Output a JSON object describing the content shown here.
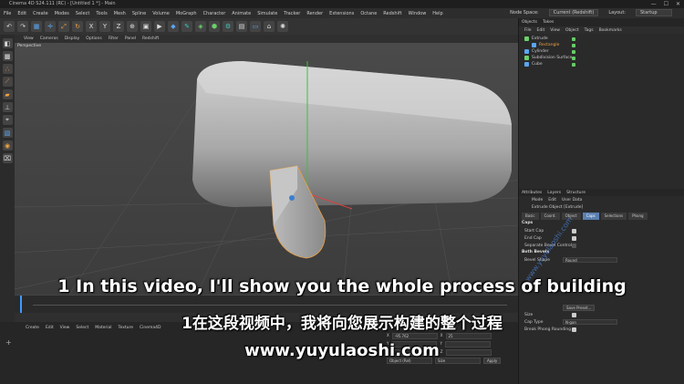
{
  "window": {
    "title": "Cinema 4D S24.111 (RC) - [Untitled 1 *] - Main"
  },
  "menu": [
    "File",
    "Edit",
    "Create",
    "Modes",
    "Select",
    "Tools",
    "Mesh",
    "Spline",
    "Volume",
    "MoGraph",
    "Character",
    "Animate",
    "Simulate",
    "Tracker",
    "Render",
    "Extensions",
    "Octane",
    "Redshift",
    "Window",
    "Help"
  ],
  "node_space": {
    "label": "Node Space:",
    "value": "Current (Redshift)"
  },
  "layout": {
    "label": "Layout:",
    "value": "Startup"
  },
  "viewport": {
    "menu": [
      "View",
      "Cameras",
      "Display",
      "Options",
      "Filter",
      "Panel",
      "Redshift"
    ],
    "label": "Perspective"
  },
  "right_panel": {
    "tabs": [
      "Objects",
      "Takes"
    ],
    "obj_menu": [
      "File",
      "Edit",
      "View",
      "Object",
      "Tags",
      "Bookmarks"
    ],
    "objects": [
      {
        "name": "Extrude",
        "color": "#6cd06c"
      },
      {
        "name": "Rectangle",
        "color": "#5aa6f0"
      },
      {
        "name": "Cylinder",
        "color": "#5aa6f0"
      },
      {
        "name": "Subdivision Surface",
        "color": "#6cd06c"
      },
      {
        "name": "Cube",
        "color": "#5aa6f0"
      }
    ],
    "attr_tabs": [
      "Attributes",
      "Layers",
      "Structure"
    ],
    "attr_menu": [
      "Mode",
      "Edit",
      "User Data"
    ],
    "object_title": "Extrude Object [Extrude]",
    "subtabs": [
      "Basic",
      "Coord.",
      "Object",
      "Caps",
      "Selections",
      "Phong"
    ],
    "active_subtab": "Caps",
    "caps_section": "Caps",
    "props": [
      {
        "label": "Start Cap"
      },
      {
        "label": "End Cap"
      },
      {
        "label": "Separate Bevel Controls"
      }
    ],
    "bevels_section": "Both Bevels",
    "bevel_shape": {
      "label": "Bevel Shape",
      "value": "Round"
    },
    "more_props": [
      {
        "label": "Size"
      },
      {
        "label": "Cap Type",
        "value": "N-gon"
      },
      {
        "label": "Break Phong Rounding"
      }
    ]
  },
  "material": {
    "menu": [
      "Create",
      "Edit",
      "View",
      "Select",
      "Material",
      "Texture",
      "Cinema4D"
    ]
  },
  "coords": {
    "x": "-95.762",
    "y": "25",
    "z": "",
    "object_mode": "Object (Rel)",
    "size_mode": "Size",
    "apply": "Apply",
    "save_preset": "Save Preset..."
  },
  "subtitles": {
    "en": "1 In this video, I'll show you the whole process of building",
    "zh": "1在这段视频中，我将向您展示构建的整个过程",
    "url": "www.yuyulaoshi.com"
  },
  "watermark": "www.yuyulaoshi.com"
}
